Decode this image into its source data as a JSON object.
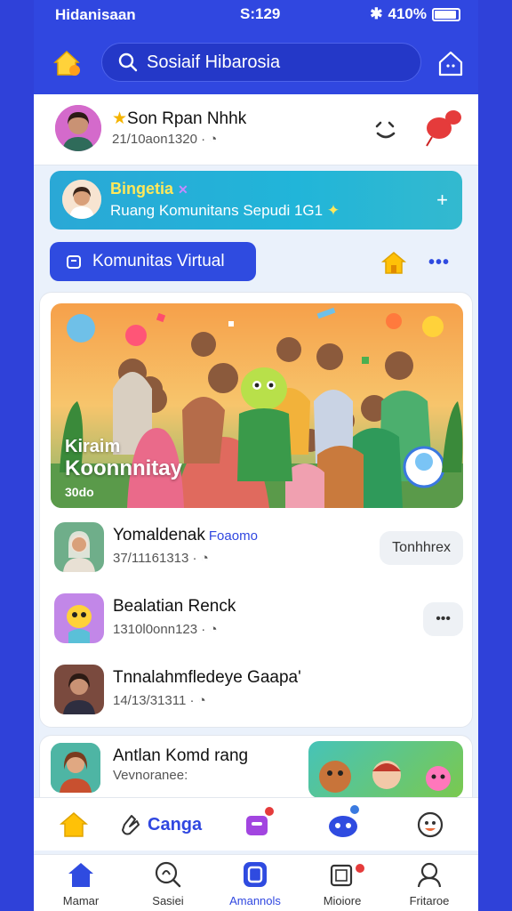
{
  "status": {
    "carrier": "Hidanisaan",
    "time": "S:129",
    "battery": "410%"
  },
  "search": {
    "placeholder": "Sosiaif Hibarosia"
  },
  "profile": {
    "name": "Son Rpan Nhhk",
    "meta": "21/10aon1320 ·"
  },
  "banner": {
    "title": "Bingetia",
    "subtitle": "Ruang Komunitans Sepudi 1G1",
    "action": "+"
  },
  "virtual_button": {
    "label": "Komunitas Virtual"
  },
  "more": "•••",
  "hero": {
    "line1": "Kiraim",
    "line2": "Koonnnitay",
    "line3": "30do"
  },
  "posts": [
    {
      "name": "Yomaldenak",
      "tag": "Foaomo",
      "meta": "37/11161313 ·",
      "action": "Tonhhrex"
    },
    {
      "name": "Bealatian Renck",
      "meta": "1310l0onn123 ·",
      "action": "•••"
    },
    {
      "name": "Tnnalahmfledeye Gaapa'",
      "meta": "14/13/31311 ·"
    }
  ],
  "second_card": {
    "name": "Antlan Komd rang",
    "sub": "Vevnoranee:"
  },
  "icon_bar": {
    "item1": "Canga"
  },
  "nav": [
    {
      "label": "Mamar"
    },
    {
      "label": "Sasiei"
    },
    {
      "label": "Amannols"
    },
    {
      "label": "Mioiore"
    },
    {
      "label": "Fritaroe"
    }
  ],
  "colors": {
    "primary": "#3047e0",
    "banner": "#21b5d9",
    "accent": "#ffc107"
  }
}
